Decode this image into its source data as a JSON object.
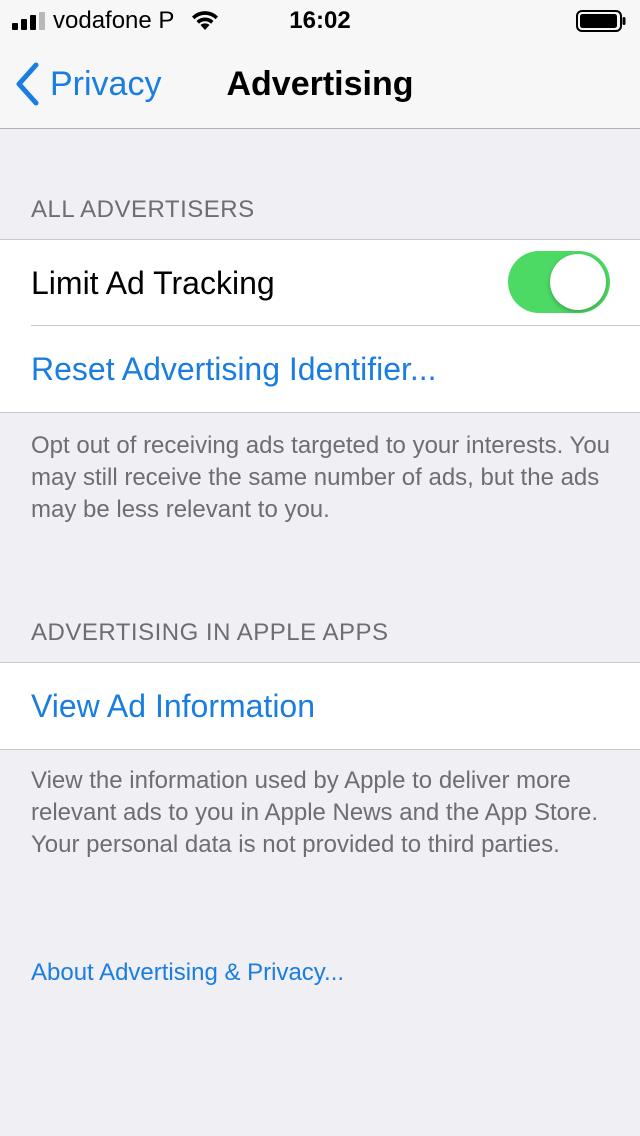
{
  "status_bar": {
    "carrier": "vodafone P",
    "time": "16:02",
    "signal_bars_active": 3,
    "signal_bars_total": 4,
    "battery_level": 0.9
  },
  "nav": {
    "back_label": "Privacy",
    "title": "Advertising",
    "accent_color": "#1a7de0"
  },
  "all_advertisers": {
    "header": "ALL ADVERTISERS",
    "limit_ad_tracking_label": "Limit Ad Tracking",
    "limit_ad_tracking_on": true,
    "toggle_color": "#4cd964",
    "reset_label": "Reset Advertising Identifier...",
    "footer": "Opt out of receiving ads targeted to your interests. You may still receive the same number of ads, but the ads may be less relevant to you."
  },
  "apple_apps": {
    "header": "ADVERTISING IN APPLE APPS",
    "view_label": "View Ad Information",
    "footer": "View the information used by Apple to deliver more relevant ads to you in Apple News and the App Store. Your personal data is not provided to third parties."
  },
  "about_link": "About Advertising & Privacy..."
}
